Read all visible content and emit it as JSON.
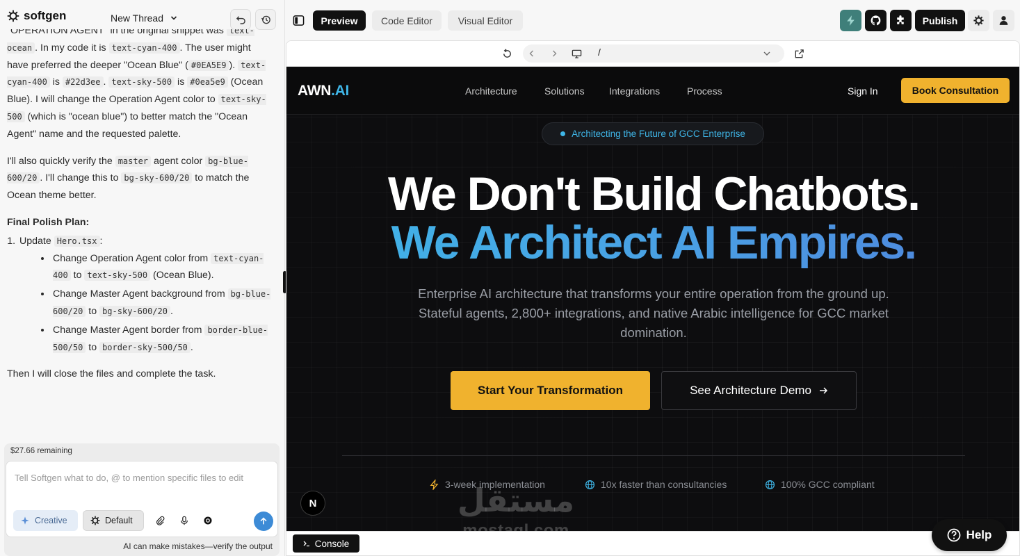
{
  "app": {
    "name": "softgen",
    "thread_title": "New Thread"
  },
  "chat": {
    "line1_prefix": "\"OPERATION AGENT\" in the original snippet was ",
    "code_text_ocean": "text-ocean",
    "line1_mid": ". In my code it is ",
    "code_text_cyan_400": "text-cyan-400",
    "line1_suffix": ". The user might have preferred the deeper \"Ocean Blue\" (",
    "code_hex_ocean": "#0EA5E9",
    "line1_end": ").",
    "code_text_cyan_400_b": "text-cyan-400",
    "is_word": " is ",
    "code_hex_cyan": "#22d3ee",
    "dot_space": ". ",
    "code_text_sky_500": "text-sky-500",
    "is_word_b": " is ",
    "code_hex_sky": "#0ea5e9",
    "line2_suffix": " (Ocean Blue). I will change the Operation Agent color to ",
    "code_text_sky_500_b": "text-sky-500",
    "line2_end": " (which is \"ocean blue\") to better match the \"Ocean Agent\" name and the requested palette.",
    "p2_prefix": "I'll also quickly verify the ",
    "code_master": "master",
    "p2_mid": " agent color ",
    "code_bg_blue": "bg-blue-600/20",
    "p2_mid2": ". I'll change this to ",
    "code_bg_sky": "bg-sky-600/20",
    "p2_end": " to match the Ocean theme better.",
    "plan_title": "Final Polish Plan:",
    "step1_prefix": "Update ",
    "step1_code": "Hero.tsx",
    "step1_suffix": ":",
    "b1_prefix": "Change Operation Agent color from ",
    "b1_code1": "text-cyan-400",
    "b1_to": " to ",
    "b1_code2": "text-sky-500",
    "b1_end": " (Ocean Blue).",
    "b2_prefix": "Change Master Agent background from ",
    "b2_code1": "bg-blue-600/20",
    "b2_to": " to ",
    "b2_code2": "bg-sky-600/20",
    "b2_end": ".",
    "b3_prefix": "Change Master Agent border from ",
    "b3_code1": "border-blue-500/50",
    "b3_to": " to ",
    "b3_code2": "border-sky-500/50",
    "b3_end": ".",
    "closing": "Then I will close the files and complete the task."
  },
  "composer": {
    "remaining": "$27.66 remaining",
    "placeholder": "Tell Softgen what to do, @ to mention specific files to edit",
    "mode_creative": "Creative",
    "mode_default": "Default",
    "disclaimer": "AI can make mistakes—verify the output"
  },
  "topbar": {
    "tabs": [
      "Preview",
      "Code Editor",
      "Visual Editor"
    ],
    "publish": "Publish"
  },
  "browser": {
    "url": "/"
  },
  "site": {
    "brand_main": "AWN",
    "brand_dot_ai": ".AI",
    "nav": [
      "Architecture",
      "Solutions",
      "Integrations",
      "Process"
    ],
    "sign_in": "Sign In",
    "book": "Book Consultation",
    "badge": "Architecting the Future of GCC Enterprise",
    "headline_1": "We Don't Build Chatbots.",
    "headline_2": "We Architect AI Empires.",
    "subheadline": "Enterprise AI architecture that transforms your entire operation from the ground up. Stateful agents, 2,800+ integrations, and native Arabic intelligence for GCC market domination.",
    "cta_primary": "Start Your Transformation",
    "cta_secondary": "See Architecture Demo",
    "features": [
      "3-week implementation",
      "10x faster than consultancies",
      "100% GCC compliant"
    ],
    "framework_badge": "N"
  },
  "watermark": {
    "arabic": "مستقل",
    "latin": "mostaql.com"
  },
  "footer": {
    "console": "Console",
    "help": "Help"
  },
  "colors": {
    "accent_gold": "#f0b22e",
    "ocean_blue": "#3fb6e8",
    "dark_bg": "#0d0d0f"
  }
}
